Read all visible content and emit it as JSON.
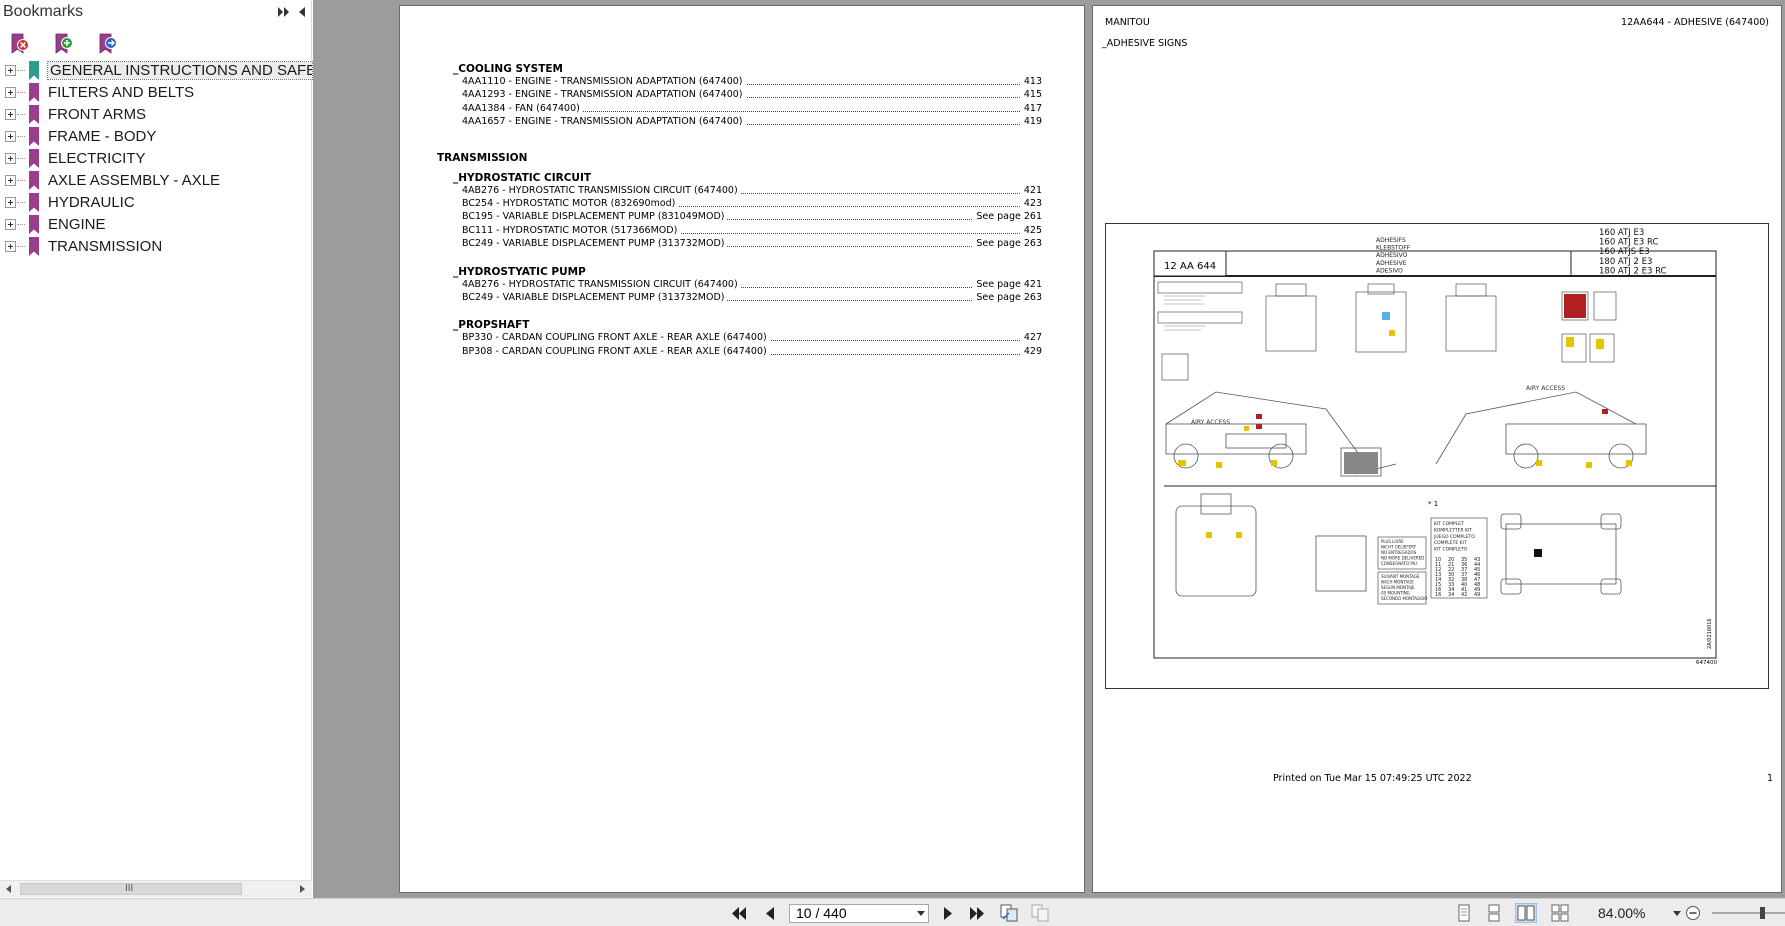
{
  "sidebar": {
    "title": "Bookmarks",
    "tools": [
      {
        "name": "delete-bookmark-icon",
        "color": "#d03030"
      },
      {
        "name": "add-bookmark-icon",
        "color": "#2f9a3a"
      },
      {
        "name": "add-child-bookmark-icon",
        "color": "#3060c8"
      }
    ],
    "bookmarks": [
      {
        "label": "GENERAL INSTRUCTIONS AND SAFETY",
        "selected": true,
        "flag_color": "#2e9a8a"
      },
      {
        "label": "FILTERS AND BELTS",
        "flag_color": "#9a3d8c"
      },
      {
        "label": "FRONT ARMS",
        "flag_color": "#9a3d8c"
      },
      {
        "label": "FRAME - BODY",
        "flag_color": "#9a3d8c"
      },
      {
        "label": "ELECTRICITY",
        "flag_color": "#9a3d8c"
      },
      {
        "label": "AXLE ASSEMBLY - AXLE",
        "flag_color": "#9a3d8c"
      },
      {
        "label": "HYDRAULIC",
        "flag_color": "#9a3d8c"
      },
      {
        "label": "ENGINE",
        "flag_color": "#9a3d8c"
      },
      {
        "label": "TRANSMISSION",
        "flag_color": "#9a3d8c"
      }
    ],
    "scroll_grip": "III"
  },
  "left_page": {
    "sections": [
      {
        "heading": "_COOLING SYSTEM",
        "entries": [
          {
            "text": "4AA1110 - ENGINE - TRANSMISSION ADAPTATION (647400)",
            "page": "413"
          },
          {
            "text": "4AA1293 - ENGINE - TRANSMISSION ADAPTATION (647400)",
            "page": "415"
          },
          {
            "text": "4AA1384 - FAN (647400)",
            "page": "417"
          },
          {
            "text": "4AA1657 - ENGINE - TRANSMISSION ADAPTATION (647400)",
            "page": "419"
          }
        ]
      },
      {
        "chapter": "TRANSMISSION"
      },
      {
        "heading": "_HYDROSTATIC CIRCUIT",
        "entries": [
          {
            "text": "4AB276 - HYDROSTATIC TRANSMISSION CIRCUIT (647400)",
            "page": "421"
          },
          {
            "text": "BC254 - HYDROSTATIC MOTOR (832690mod)",
            "page": "423"
          },
          {
            "text": "BC195 - VARIABLE DISPLACEMENT PUMP (831049MOD)",
            "page": "See page 261"
          },
          {
            "text": "BC111 - HYDROSTATIC MOTOR (517366MOD)",
            "page": "425"
          },
          {
            "text": "BC249 - VARIABLE DISPLACEMENT PUMP (313732MOD)",
            "page": "See page 263"
          }
        ]
      },
      {
        "heading": "_HYDROSTYATIC PUMP",
        "entries": [
          {
            "text": "4AB276 - HYDROSTATIC TRANSMISSION CIRCUIT (647400)",
            "page": "See page 421"
          },
          {
            "text": "BC249 - VARIABLE DISPLACEMENT PUMP (313732MOD)",
            "page": "See page 263"
          }
        ]
      },
      {
        "heading": "_PROPSHAFT",
        "entries": [
          {
            "text": "BP330 - CARDAN COUPLING FRONT AXLE - REAR AXLE (647400)",
            "page": "427"
          },
          {
            "text": "BP308 - CARDAN COUPLING FRONT AXLE - REAR AXLE (647400)",
            "page": "429"
          }
        ]
      }
    ]
  },
  "right_page": {
    "brand": "MANITOU",
    "ref": "12AA644 - ADHESIVE (647400)",
    "section": "_ADHESIVE SIGNS",
    "footer_printed": "Printed on  Tue Mar 15 07:49:25 UTC 2022",
    "page_number": "1",
    "figure": {
      "ref_box": "12 AA 644",
      "languages": [
        "ADHESIFS",
        "KLEBSTOFF",
        "ADHESIVO",
        "ADHESIVE",
        "ADESIVO"
      ],
      "models": [
        "160 ATJ E3",
        "160 ATJ E3 RC",
        "160 ATJS E3",
        "180 ATJ 2 E3",
        "180 ATJ 2 E3 RC"
      ],
      "kit_marker": "* 1",
      "kit_lines": [
        "KIT COMPLET",
        "KOMPLETTER KIT",
        "JUEGO COMPLETO",
        "COMPLETE KIT",
        "KIT COMPLETO"
      ],
      "kit_numbers": [
        [
          "10",
          "20",
          "35",
          "43"
        ],
        [
          "11",
          "21",
          "36",
          "44"
        ],
        [
          "12",
          "22",
          "37",
          "45"
        ],
        [
          "13",
          "30",
          "37",
          "46"
        ],
        [
          "14",
          "32",
          "38",
          "47"
        ],
        [
          "15",
          "33",
          "40",
          "48"
        ],
        [
          "16",
          "34",
          "41",
          "49"
        ],
        [
          "16",
          "34",
          "42",
          "49"
        ]
      ],
      "legend_small_1": [
        "PLUS LIVRE",
        "NICHT GELIEFERT",
        "NO ENTREGADOS",
        "NO MORE DELIVERED",
        "CONSEGNATO PIU"
      ],
      "legend_small_2": [
        "SUIVANT MONTAGE",
        "NACH MONTAGE",
        "SEGUN MONTAJE",
        "AS MOUNTING",
        "SECONDO MONTAGGIO"
      ],
      "brand_on_machine": "AIRY ACCESS",
      "fig_code": "647400",
      "fig_side": "2A/0216016"
    }
  },
  "toolbar": {
    "page_value": "10 / 440",
    "zoom_value": "84.00%"
  }
}
